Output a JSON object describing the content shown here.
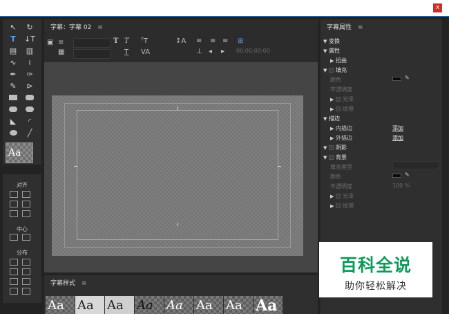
{
  "window": {
    "close_label": "x"
  },
  "editor": {
    "title": "字幕：字幕 02",
    "menu_icon": "≡",
    "timecode": "00;00;00;00"
  },
  "tools": {
    "preview_text": "Aa"
  },
  "align_panel": {
    "align_label": "对齐",
    "center_label": "中心",
    "distribute_label": "分布"
  },
  "styles": {
    "title": "字幕样式",
    "menu_icon": "≡",
    "swatches": [
      "Aa",
      "Aa",
      "Aa",
      "Aa",
      "Aa",
      "Aa",
      "Aa",
      "Aa"
    ]
  },
  "properties": {
    "title": "字幕属性",
    "menu_icon": "≡",
    "transform": "变换",
    "attributes": "属性",
    "distort": "扭曲",
    "fill": "填充",
    "color": "颜色",
    "opacity": "不透明度",
    "sheen": "光泽",
    "texture": "纹理",
    "stroke": "描边",
    "inner_stroke": "内描边",
    "outer_stroke": "外描边",
    "add": "添加",
    "shadow": "阴影",
    "background": "背景",
    "fill_type": "填充类型",
    "bg_color": "颜色",
    "bg_opacity": "不透明度",
    "bg_opacity_value": "100 %",
    "bg_sheen": "光泽",
    "bg_texture": "纹理"
  },
  "watermark": {
    "main": "百科全说",
    "sub": "助你轻松解决"
  },
  "colors": {
    "accent": "#2b7fc9",
    "watermark_green": "#0d9a5a"
  }
}
